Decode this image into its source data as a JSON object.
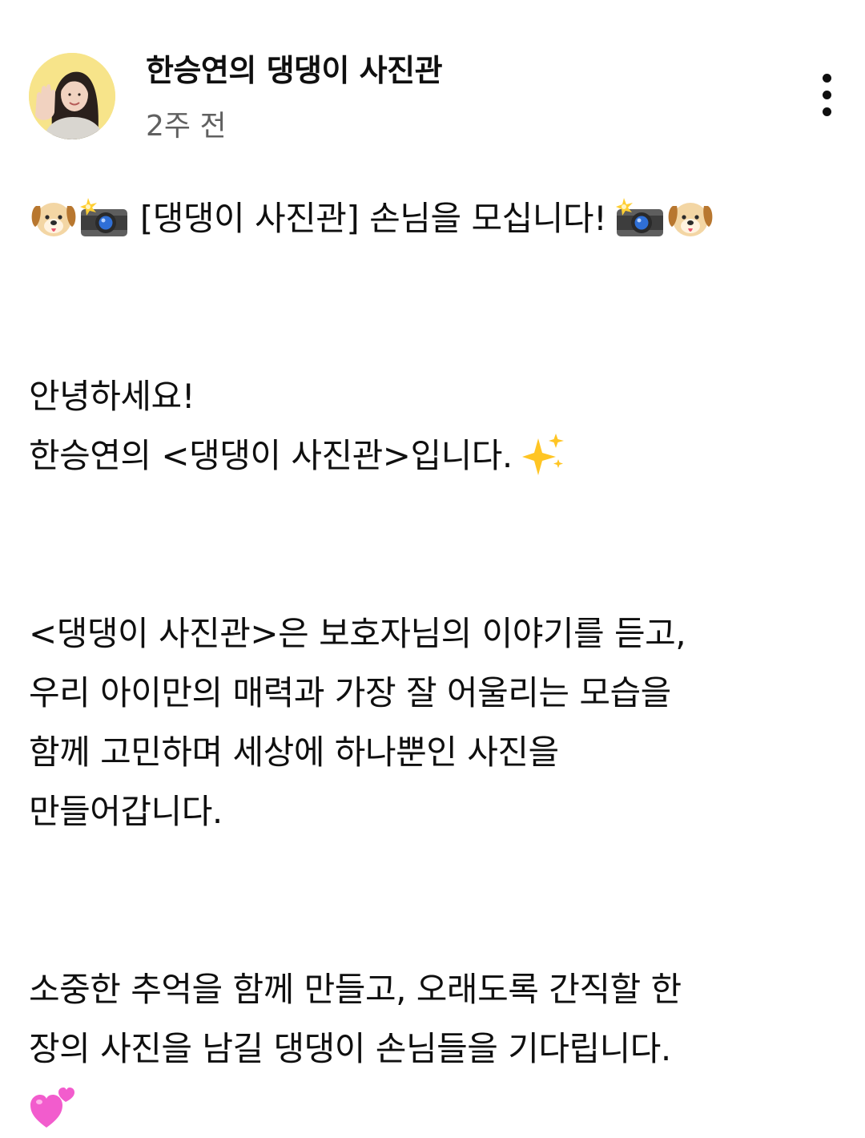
{
  "header": {
    "channel_name": "한승연의 댕댕이 사진관",
    "time_ago": "2주 전"
  },
  "post": {
    "title": "[댕댕이 사진관] 손님을 모십니다!",
    "intro": [
      "안녕하세요!",
      "한승연의 <댕댕이 사진관>입니다."
    ],
    "paragraph2": [
      "<댕댕이 사진관>은 보호자님의 이야기를 듣고,",
      "우리 아이만의 매력과 가장 잘 어울리는 모습을",
      "함께 고민하며 세상에 하나뿐인 사진을",
      "만들어갑니다."
    ],
    "paragraph3": [
      "소중한 추억을 함께 만들고, 오래도록 간직할 한",
      "장의 사진을 남길 댕댕이 손님들을 기다립니다."
    ]
  },
  "icons": {
    "title_left": [
      "dog-face-icon",
      "camera-flash-icon"
    ],
    "title_right": [
      "camera-flash-icon",
      "dog-face-icon"
    ],
    "intro_end": "sparkles-icon",
    "closing": "two-hearts-icon"
  },
  "colors": {
    "text": "#0f0f0f",
    "secondary_text": "#606060",
    "avatar_background": "#f7e48a",
    "heart": "#f25ccd"
  }
}
